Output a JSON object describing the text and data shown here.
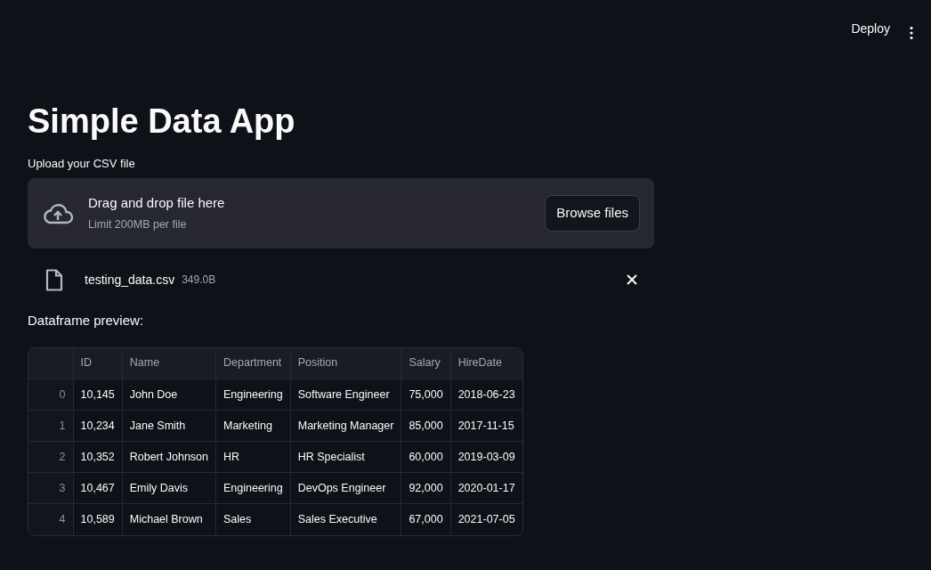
{
  "header": {
    "deploy": "Deploy"
  },
  "title": "Simple Data App",
  "uploader": {
    "label": "Upload your CSV file",
    "instruction": "Drag and drop file here",
    "limit": "Limit 200MB per file",
    "button": "Browse files"
  },
  "file": {
    "name": "testing_data.csv",
    "size": "349.0B"
  },
  "preview_label": "Dataframe preview:",
  "table": {
    "columns": [
      "ID",
      "Name",
      "Department",
      "Position",
      "Salary",
      "HireDate"
    ],
    "rows": [
      {
        "index": "0",
        "cells": [
          "10,145",
          "John Doe",
          "Engineering",
          "Software Engineer",
          "75,000",
          "2018-06-23"
        ]
      },
      {
        "index": "1",
        "cells": [
          "10,234",
          "Jane Smith",
          "Marketing",
          "Marketing Manager",
          "85,000",
          "2017-11-15"
        ]
      },
      {
        "index": "2",
        "cells": [
          "10,352",
          "Robert Johnson",
          "HR",
          "HR Specialist",
          "60,000",
          "2019-03-09"
        ]
      },
      {
        "index": "3",
        "cells": [
          "10,467",
          "Emily Davis",
          "Engineering",
          "DevOps Engineer",
          "92,000",
          "2020-01-17"
        ]
      },
      {
        "index": "4",
        "cells": [
          "10,589",
          "Michael Brown",
          "Sales",
          "Sales Executive",
          "67,000",
          "2021-07-05"
        ]
      }
    ]
  }
}
